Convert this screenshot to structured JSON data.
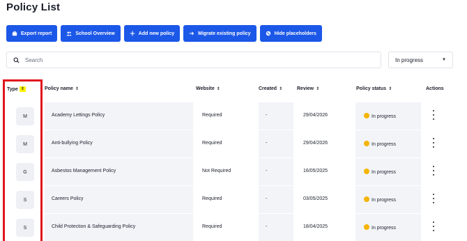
{
  "page_title": "Policy List",
  "toolbar": [
    {
      "label": "Export report",
      "icon": "briefcase-icon"
    },
    {
      "label": "School Overview",
      "icon": "users-icon"
    },
    {
      "label": "Add new policy",
      "icon": "plus-icon"
    },
    {
      "label": "Migrate existing policy",
      "icon": "arrow-right-icon"
    },
    {
      "label": "Hide placeholders",
      "icon": "eye-off-icon"
    }
  ],
  "search": {
    "placeholder": "Search",
    "value": ""
  },
  "status_filter": {
    "selected": "In progress"
  },
  "columns": {
    "type": "Type",
    "name": "Policy name",
    "website": "Website",
    "created": "Created",
    "review": "Review",
    "status": "Policy status",
    "actions": "Actions"
  },
  "rows": [
    {
      "type": "M",
      "name": "Academy Lettings Policy",
      "website": "Required",
      "created": "-",
      "review": "29/04/2026",
      "status": "In progress"
    },
    {
      "type": "M",
      "name": "Anti-bullying Policy",
      "website": "Required",
      "created": "-",
      "review": "29/04/2026",
      "status": "In progress"
    },
    {
      "type": "G",
      "name": "Asbestos Management Policy",
      "website": "Not Required",
      "created": "-",
      "review": "16/05/2025",
      "status": "In progress"
    },
    {
      "type": "S",
      "name": "Careers Policy",
      "website": "Required",
      "created": "-",
      "review": "03/05/2025",
      "status": "In progress"
    },
    {
      "type": "S",
      "name": "Child Protection & Safeguarding Policy",
      "website": "Required",
      "created": "-",
      "review": "18/04/2025",
      "status": "In progress"
    }
  ],
  "colors": {
    "primary": "#1c58e8",
    "status_in_progress": "#f5b400",
    "annotation": "#e0161d",
    "sort_highlight": "#fff200"
  }
}
